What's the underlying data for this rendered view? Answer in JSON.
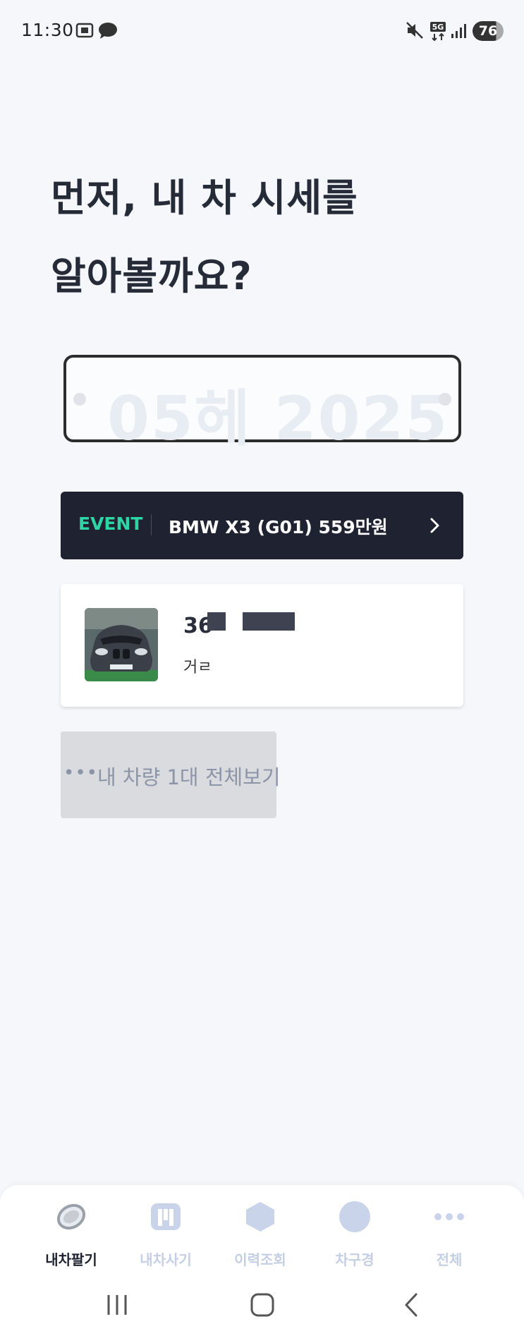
{
  "status_bar": {
    "time": "11:30",
    "battery": "76",
    "network": "5G"
  },
  "headline": {
    "line1": "먼저, 내 차 시세를",
    "line2": "알아볼까요?"
  },
  "plate_input": {
    "placeholder": "05헤 2025"
  },
  "event_banner": {
    "tag": "EVENT",
    "text": "BMW X3 (G01) 559만원",
    "accent_color": "#2bd6a4",
    "background": "#1f2231"
  },
  "car_card": {
    "plate_prefix": "36",
    "subtitle": "거ㄹ"
  },
  "view_all": {
    "dots": "•••",
    "label": "내 차량 1대 전체보기"
  },
  "bottom_nav": {
    "items": [
      {
        "label": "내차팔기",
        "icon": "coin-icon",
        "active": true
      },
      {
        "label": "내차사기",
        "icon": "m-logo-icon",
        "active": false
      },
      {
        "label": "이력조회",
        "icon": "hexagon-icon",
        "active": false
      },
      {
        "label": "차구경",
        "icon": "circle-icon",
        "active": false
      },
      {
        "label": "전체",
        "icon": "more-dots-icon",
        "active": false
      }
    ]
  }
}
